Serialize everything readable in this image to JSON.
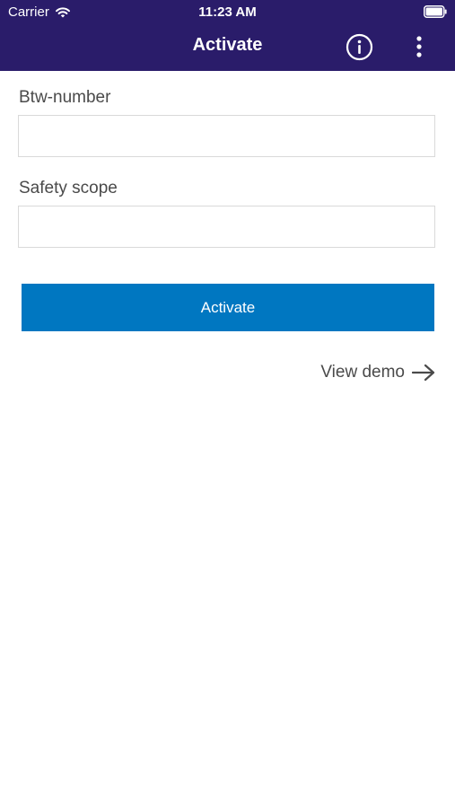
{
  "status_bar": {
    "carrier": "Carrier",
    "time": "11:23 AM"
  },
  "nav": {
    "title": "Activate",
    "info_icon": "info-circle-icon",
    "more_icon": "more-vertical-icon"
  },
  "form": {
    "btw_label": "Btw-number",
    "btw_value": "",
    "scope_label": "Safety scope",
    "scope_value": ""
  },
  "actions": {
    "activate_label": "Activate",
    "demo_label": "View demo",
    "demo_icon": "arrow-right-icon"
  },
  "colors": {
    "header_bg": "#2a1c6a",
    "primary_button": "#0077c1",
    "text": "#4a4a4a"
  }
}
